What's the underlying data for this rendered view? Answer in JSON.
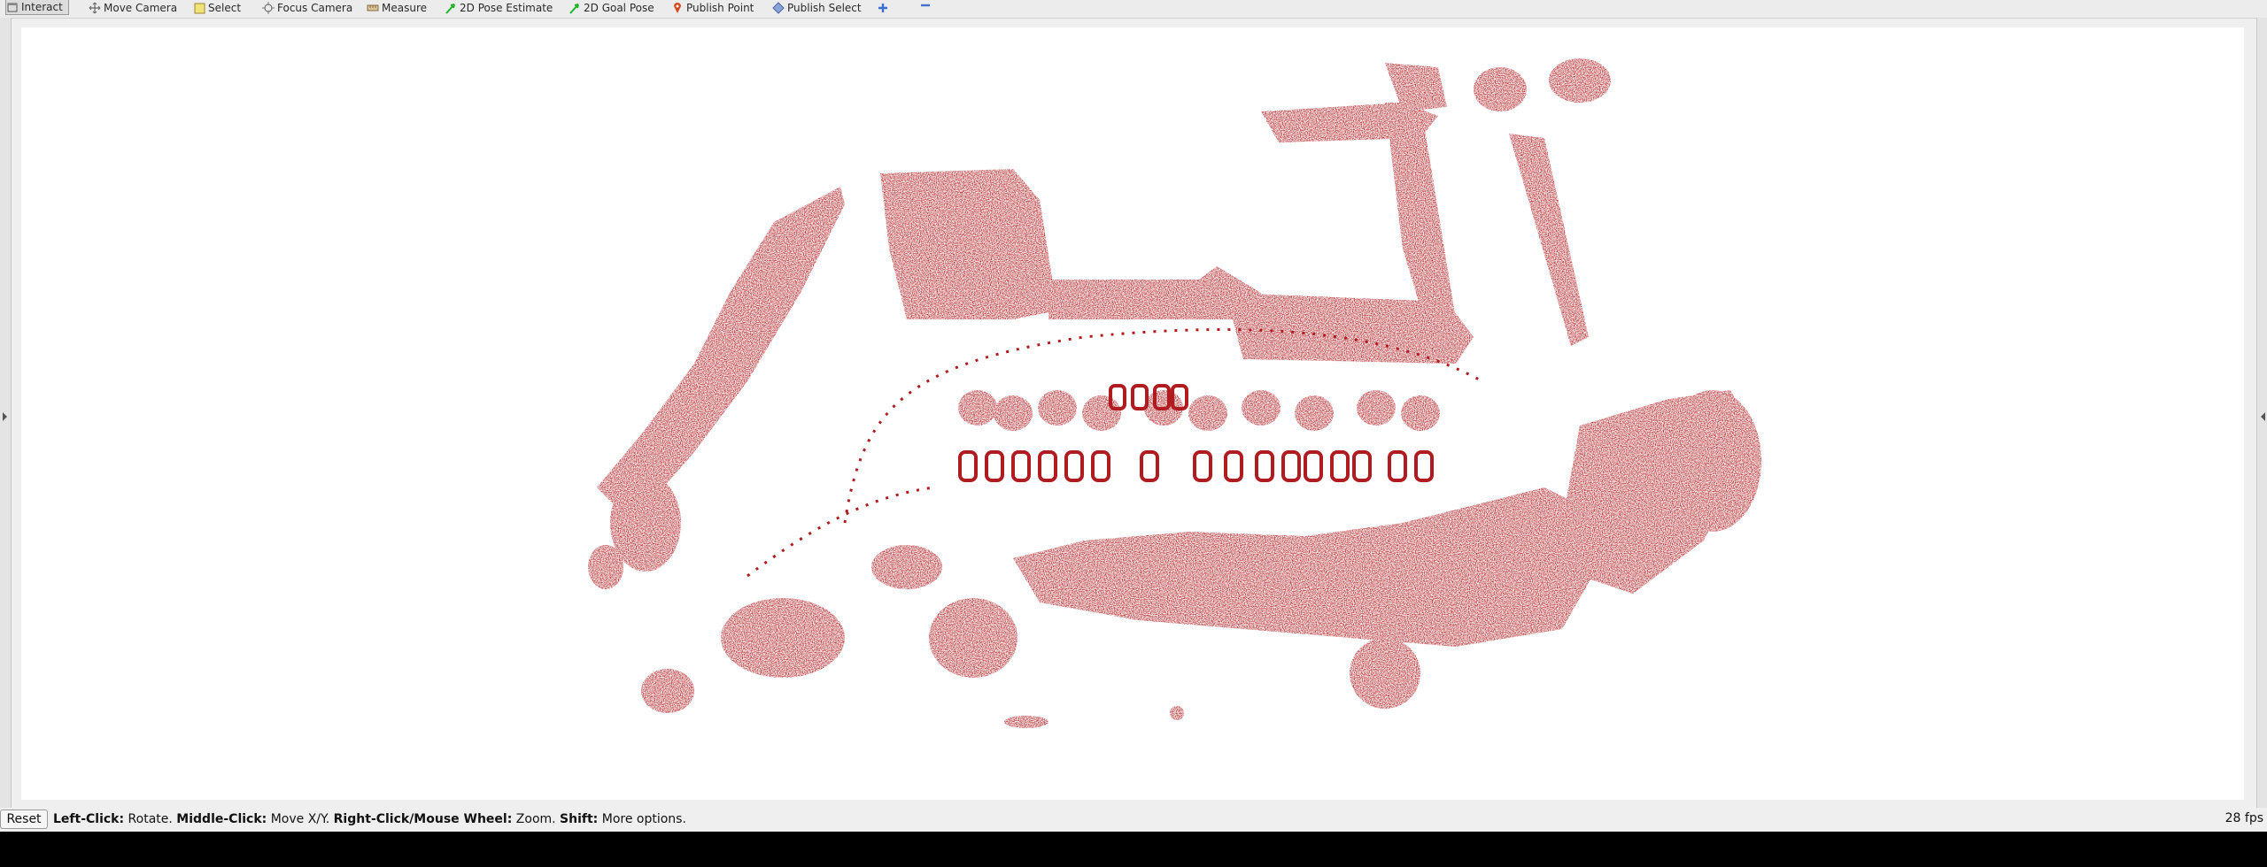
{
  "toolbar": {
    "tools": [
      {
        "label": "Interact",
        "icon": "cursor-icon",
        "active": true
      },
      {
        "label": "Move Camera",
        "icon": "move-camera-icon"
      },
      {
        "label": "Select",
        "icon": "select-icon"
      },
      {
        "label": "Focus Camera",
        "icon": "focus-camera-icon"
      },
      {
        "label": "Measure",
        "icon": "ruler-icon"
      },
      {
        "label": "2D Pose Estimate",
        "icon": "green-arrow-icon"
      },
      {
        "label": "2D Goal Pose",
        "icon": "green-arrow-icon"
      },
      {
        "label": "Publish Point",
        "icon": "pin-icon"
      },
      {
        "label": "Publish Select",
        "icon": "publish-select-icon"
      }
    ],
    "add_tool_icon": "plus-icon",
    "remove_tool_icon": "minus-icon"
  },
  "viewport": {
    "background": "#ffffff",
    "point_color": "#b01b1f"
  },
  "statusbar": {
    "reset_label": "Reset",
    "hint": {
      "left_click_key": "Left-Click:",
      "left_click_action": "Rotate.",
      "middle_click_key": "Middle-Click:",
      "middle_click_action": "Move X/Y.",
      "right_click_key": "Right-Click/Mouse Wheel:",
      "right_click_action": "Zoom.",
      "shift_key": "Shift:",
      "shift_action": "More options."
    },
    "fps": "28 fps"
  }
}
